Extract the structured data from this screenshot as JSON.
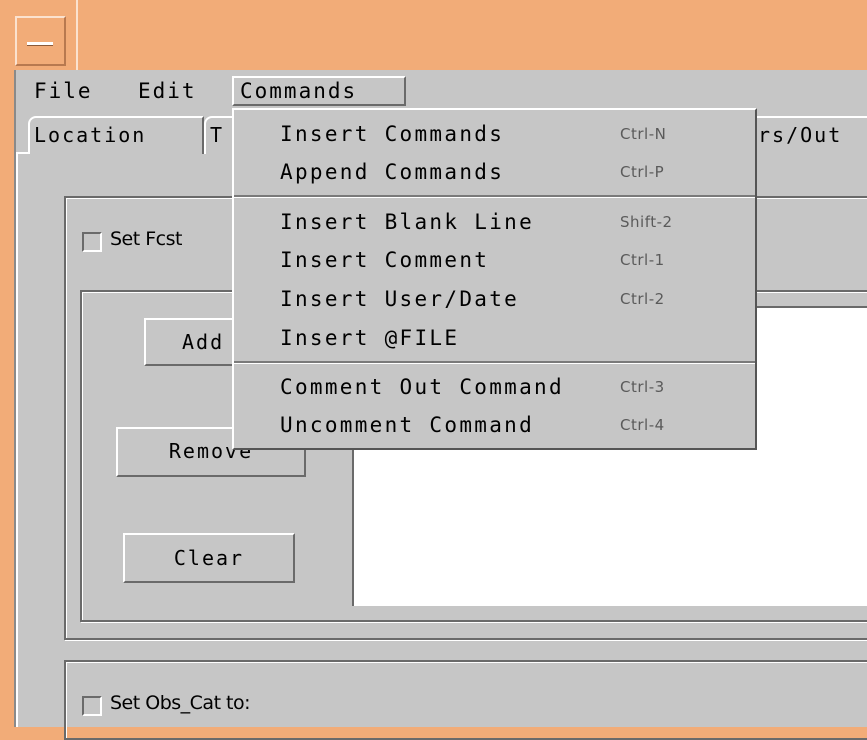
{
  "menubar": {
    "file": "File",
    "edit": "Edit",
    "commands": "Commands"
  },
  "tabs": {
    "location": "Location",
    "t_partial": "T",
    "right_partial": "rs/Out"
  },
  "fcst_group": {
    "checkbox_label": "Set Fcst",
    "add_button": "Add",
    "remove_button": "Remove",
    "clear_button": "Clear"
  },
  "obs_group": {
    "checkbox_label": "Set Obs_Cat to:"
  },
  "commands_menu": {
    "items": [
      {
        "label": "Insert Commands",
        "shortcut": "Ctrl-N"
      },
      {
        "label": "Append Commands",
        "shortcut": "Ctrl-P"
      },
      {
        "label": "Insert Blank Line",
        "shortcut": "Shift-2"
      },
      {
        "label": "Insert Comment",
        "shortcut": "Ctrl-1"
      },
      {
        "label": "Insert User/Date",
        "shortcut": "Ctrl-2"
      },
      {
        "label": "Insert @FILE",
        "shortcut": ""
      },
      {
        "label": "Comment Out Command",
        "shortcut": "Ctrl-3"
      },
      {
        "label": "Uncomment Command",
        "shortcut": "Ctrl-4"
      }
    ]
  },
  "colors": {
    "title_bar": "#f2ac78",
    "panel": "#c6c6c6",
    "list_bg": "#ffffff"
  }
}
